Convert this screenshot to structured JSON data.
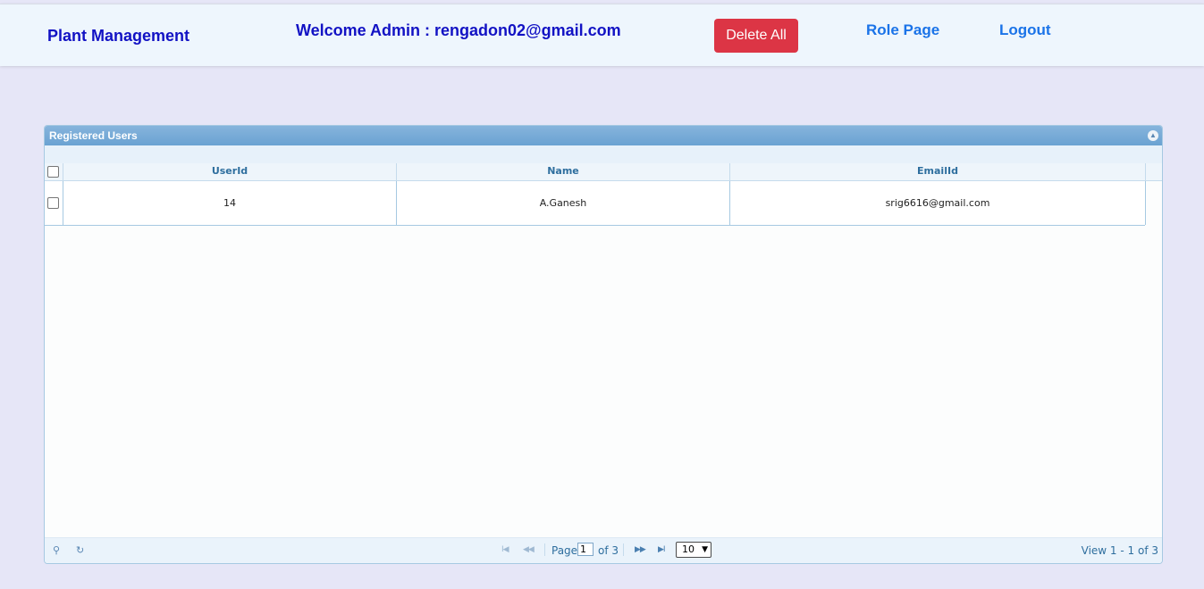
{
  "header": {
    "brand": "Plant Management",
    "welcome": "Welcome Admin : rengadon02@gmail.com",
    "delete_all": "Delete All",
    "role_page": "Role Page",
    "logout": "Logout",
    "delete_color": "#dc3545",
    "brand_color": "#1212c4"
  },
  "grid": {
    "title": "Registered Users",
    "columns": [
      "UserId",
      "Name",
      "EmailId"
    ],
    "rows": [
      {
        "user_id": "14",
        "name": "A.Ganesh",
        "email": "srig6616@gmail.com"
      }
    ]
  },
  "pager": {
    "page_label": "Page",
    "page_value": "1",
    "of_label": "of 3",
    "page_size": "10",
    "view_label": "View 1 - 1 of 3",
    "icons": [
      "search-icon",
      "refresh-icon",
      "first-page-icon",
      "prev-page-icon",
      "next-page-icon",
      "last-page-icon"
    ]
  }
}
